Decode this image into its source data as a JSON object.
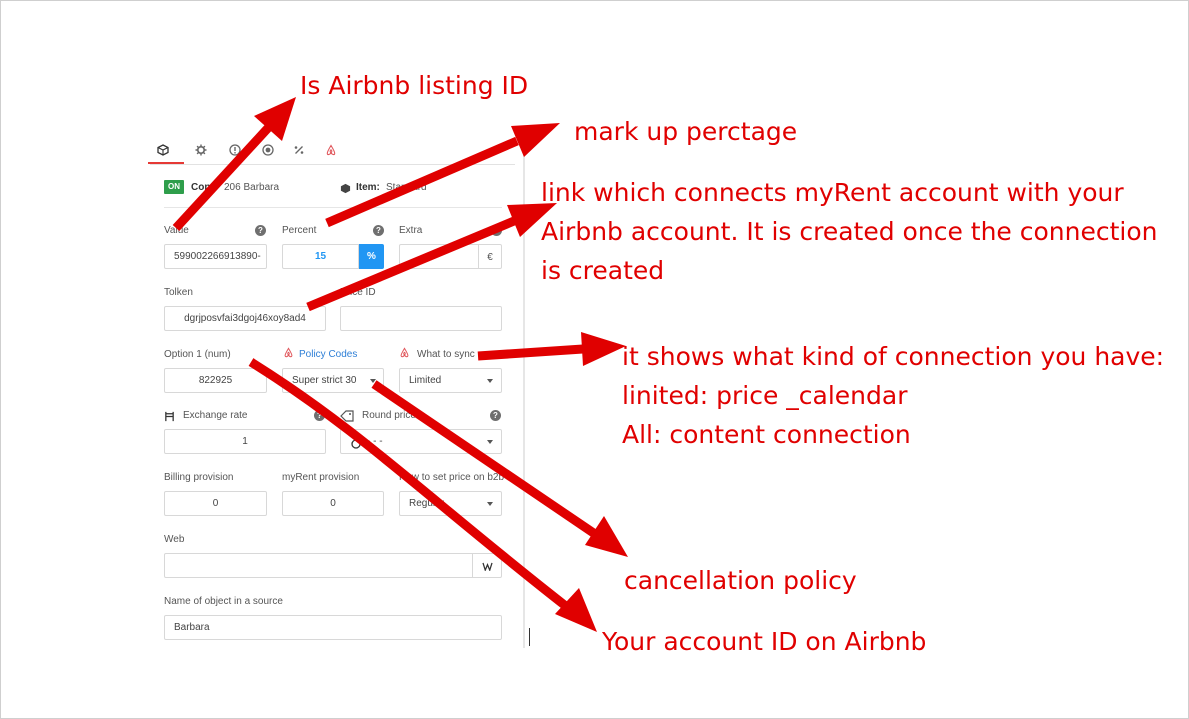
{
  "tabs": [
    {
      "icon": "cube-icon"
    },
    {
      "icon": "gear-icon"
    },
    {
      "icon": "alert-icon"
    },
    {
      "icon": "record-icon"
    },
    {
      "icon": "percent-icon"
    },
    {
      "icon": "airbnb-icon"
    }
  ],
  "header": {
    "status": "ON",
    "conn_label": "Conn",
    "conn_value": "206  Barbara",
    "item_label": "Item:",
    "item_value": "Standard"
  },
  "fields": {
    "value_label": "Value",
    "value": "599002266913890-",
    "percent_label": "Percent",
    "percent_value": "15",
    "percent_addon": "%",
    "extra_label": "Extra",
    "extra_value": "",
    "extra_addon": "€",
    "token_label": "Tolken",
    "token_value": "dgrjposvfai3dgoj46xoy8ad4",
    "price_id_label": "Price ID",
    "price_id_value": "",
    "option1_label": "Option 1 (num)",
    "option1_value": "822925",
    "policy_label": "Policy Codes",
    "policy_value": "Super strict 30",
    "sync_label": "What to sync",
    "sync_value": "Limited",
    "exchange_label": "Exchange rate",
    "exchange_value": "1",
    "round_label": "Round price",
    "round_value": "- - -",
    "billing_label": "Billing provision",
    "billing_value": "0",
    "myrent_label": "myRent provision",
    "myrent_value": "0",
    "b2b_label": "How to set price on b2b",
    "b2b_value": "Regular",
    "web_label": "Web",
    "web_value": "",
    "source_name_label": "Name of object in a source",
    "source_name_value": "Barbara"
  },
  "annotations": {
    "listing_id": "Is Airbnb listing ID",
    "markup": "mark up perctage",
    "link_line1": "link which connects myRent account with your",
    "link_line2": "Airbnb account. It is created once the connection",
    "link_line3": "is created",
    "sync_line1": "it shows what kind of connection you have:",
    "sync_line2": "linited: price _calendar",
    "sync_line3": "All: content connection",
    "cancellation": "cancellation policy",
    "account_id": "Your account ID on Airbnb"
  },
  "colors": {
    "annotation": "#e00000",
    "accent_blue": "#2196f3",
    "on_green": "#2e9e4b",
    "airbnb": "#e0565b"
  }
}
